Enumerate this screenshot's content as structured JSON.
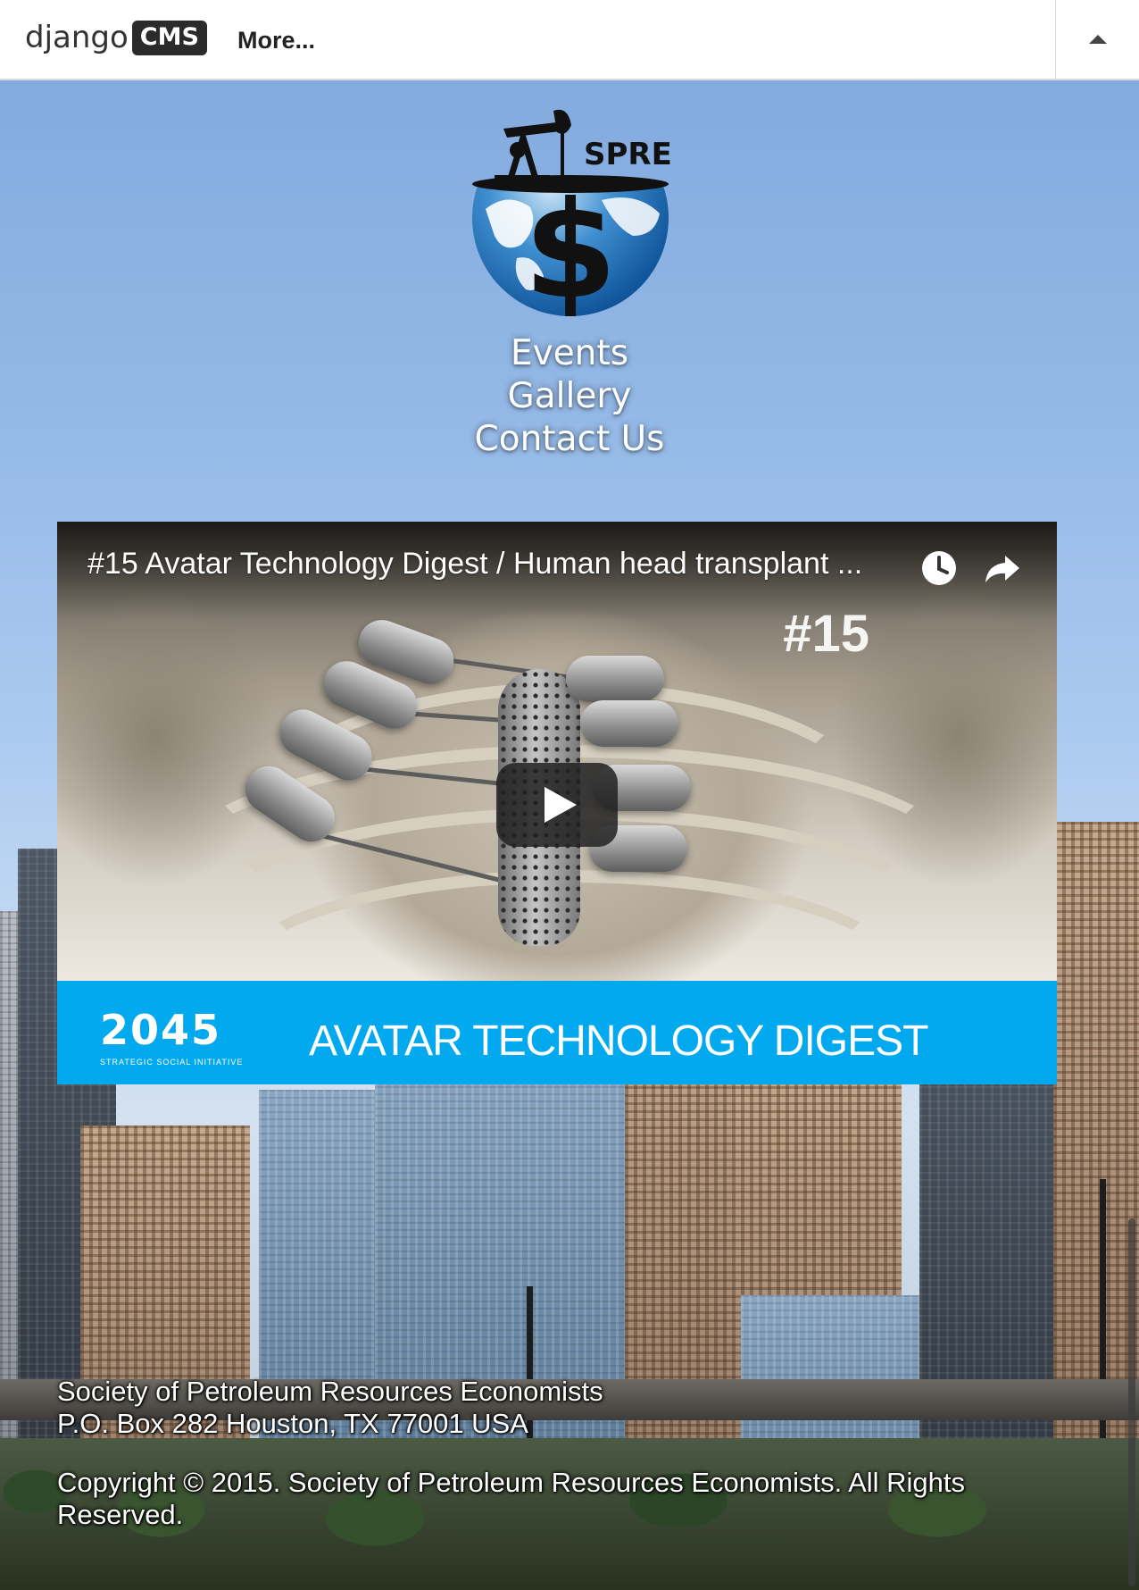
{
  "toolbar": {
    "brand_word": "django",
    "brand_box": "CMS",
    "more_label": "More...",
    "toggle_icon": "caret-up-icon"
  },
  "header": {
    "logo_text": "SPRE",
    "logo_symbol": "$"
  },
  "nav": {
    "items": [
      {
        "label": "Events"
      },
      {
        "label": "Gallery"
      },
      {
        "label": "Contact Us"
      }
    ]
  },
  "video": {
    "title": "#15 Avatar Technology Digest / Human head transplant ...",
    "overlay_number": "#15",
    "watch_later_icon": "clock-icon",
    "share_icon": "share-icon",
    "play_icon": "play-icon",
    "brand_logo": "2045",
    "brand_logo_sub": "STRATEGIC SOCIAL INITIATIVE",
    "banner_text": "AVATAR TECHNOLOGY DIGEST",
    "banner_color": "#03a9ef"
  },
  "footer": {
    "org_name": "Society of Petroleum Resources Economists",
    "address": "P.O. Box 282 Houston, TX 77001 USA",
    "copyright": "Copyright © 2015. Society of Petroleum Resources Economists. All Rights Reserved."
  }
}
